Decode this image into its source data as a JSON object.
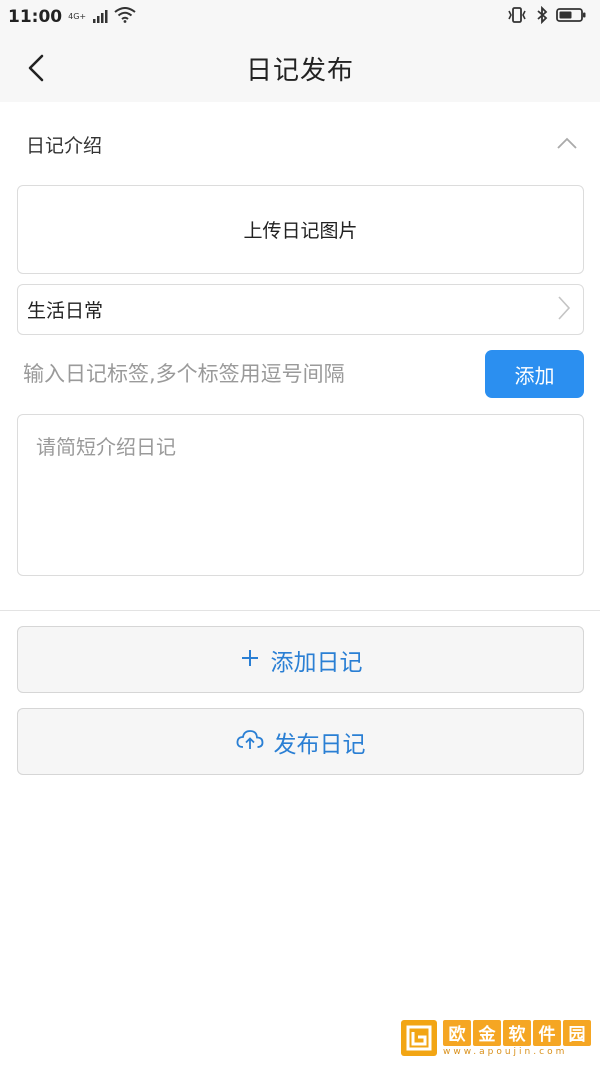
{
  "status_bar": {
    "time": "11:00",
    "network": "4G+"
  },
  "header": {
    "title": "日记发布"
  },
  "section": {
    "title": "日记介绍"
  },
  "upload": {
    "label": "上传日记图片"
  },
  "category": {
    "value": "生活日常"
  },
  "tags": {
    "placeholder": "输入日记标签,多个标签用逗号间隔",
    "add_label": "添加"
  },
  "intro": {
    "placeholder": "请简短介绍日记"
  },
  "actions": {
    "add_label": "添加日记",
    "publish_label": "发布日记"
  },
  "watermark": {
    "title_chars": [
      "欧",
      "金",
      "软",
      "件",
      "园"
    ],
    "subtitle": "www.apoujin.com"
  },
  "colors": {
    "accent": "#2b8ff0",
    "link_text": "#2a7fd4",
    "watermark": "#f5a623"
  }
}
